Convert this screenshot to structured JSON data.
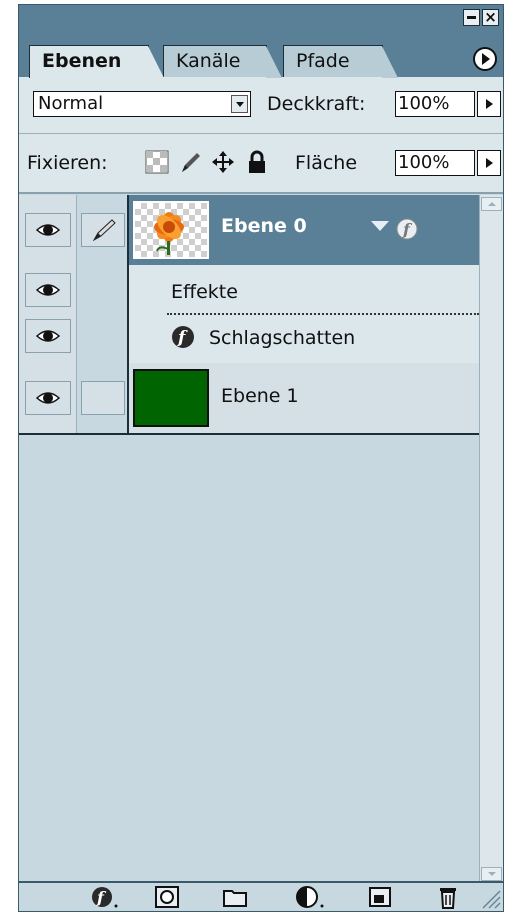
{
  "titlebar": {
    "minimize": "",
    "close": "×"
  },
  "tabs": [
    {
      "label": "Ebenen",
      "active": true
    },
    {
      "label": "Kanäle",
      "active": false
    },
    {
      "label": "Pfade",
      "active": false
    }
  ],
  "blend": {
    "mode": "Normal",
    "opacity_label": "Deckkraft:",
    "opacity_value": "100%"
  },
  "lock": {
    "label": "Fixieren:",
    "fill_label": "Fläche",
    "fill_value": "100%"
  },
  "layers": [
    {
      "name": "Ebene 0",
      "selected": true,
      "has_effects": true
    },
    {
      "name": "Ebene 1",
      "selected": false,
      "fill_color": "#006400"
    }
  ],
  "effects": {
    "header": "Effekte",
    "items": [
      "Schlagschatten"
    ]
  },
  "icons": {
    "footer": [
      "layer-style-icon",
      "mask-icon",
      "folder-icon",
      "adjustment-layer-icon",
      "new-layer-icon",
      "trash-icon"
    ]
  },
  "colors": {
    "header": "#5a8098",
    "panel": "#c8d8e0",
    "selected_row": "#5a8098"
  }
}
